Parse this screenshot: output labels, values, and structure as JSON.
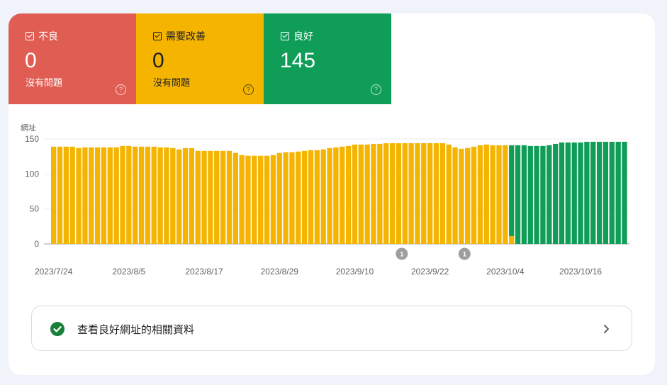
{
  "tiles": [
    {
      "label": "不良",
      "value": "0",
      "sub": "沒有問題",
      "color": "#e05d53"
    },
    {
      "label": "需要改善",
      "value": "0",
      "sub": "沒有問題",
      "color": "#f4b400"
    },
    {
      "label": "良好",
      "value": "145",
      "sub": "",
      "color": "#0f9d58"
    }
  ],
  "link": {
    "label": "查看良好網址的相關資料",
    "icon": "check-circle-icon",
    "chevron": "chevron-right-icon"
  },
  "chart_data": {
    "type": "bar",
    "ylabel": "網址",
    "ylim": [
      0,
      150
    ],
    "yticks": [
      0,
      50,
      100,
      150
    ],
    "grid": true,
    "xtick_labels": [
      "2023/7/24",
      "2023/8/5",
      "2023/8/17",
      "2023/8/29",
      "2023/9/10",
      "2023/9/22",
      "2023/10/4",
      "2023/10/16"
    ],
    "series": [
      {
        "name": "需要改善",
        "color": "#f4b400",
        "values": [
          139,
          139,
          139,
          139,
          137,
          138,
          138,
          138,
          138,
          138,
          138,
          140,
          140,
          139,
          139,
          139,
          139,
          138,
          138,
          137,
          135,
          137,
          137,
          133,
          133,
          133,
          133,
          133,
          133,
          130,
          127,
          126,
          126,
          126,
          126,
          127,
          130,
          131,
          131,
          132,
          133,
          134,
          134,
          135,
          137,
          138,
          139,
          140,
          142,
          142,
          142,
          143,
          143,
          144,
          144,
          144,
          144,
          144,
          144,
          144,
          144,
          144,
          144,
          142,
          138,
          136,
          137,
          139,
          141,
          142,
          141,
          141,
          141,
          11,
          0,
          0,
          0,
          0,
          0,
          0,
          0,
          0,
          0,
          0,
          0,
          0,
          0,
          0,
          0,
          0,
          0,
          0
        ]
      },
      {
        "name": "良好",
        "color": "#0f9d58",
        "values": [
          0,
          0,
          0,
          0,
          0,
          0,
          0,
          0,
          0,
          0,
          0,
          0,
          0,
          0,
          0,
          0,
          0,
          0,
          0,
          0,
          0,
          0,
          0,
          0,
          0,
          0,
          0,
          0,
          0,
          0,
          0,
          0,
          0,
          0,
          0,
          0,
          0,
          0,
          0,
          0,
          0,
          0,
          0,
          0,
          0,
          0,
          0,
          0,
          0,
          0,
          0,
          0,
          0,
          0,
          0,
          0,
          0,
          0,
          0,
          0,
          0,
          0,
          0,
          0,
          0,
          0,
          0,
          0,
          0,
          0,
          0,
          0,
          0,
          130,
          141,
          141,
          140,
          140,
          140,
          141,
          143,
          145,
          145,
          145,
          145,
          146,
          146,
          146,
          146,
          146,
          146,
          146
        ]
      }
    ],
    "annotations": [
      {
        "label": "1",
        "after_bar": 55
      },
      {
        "label": "1",
        "after_bar": 65
      }
    ]
  }
}
